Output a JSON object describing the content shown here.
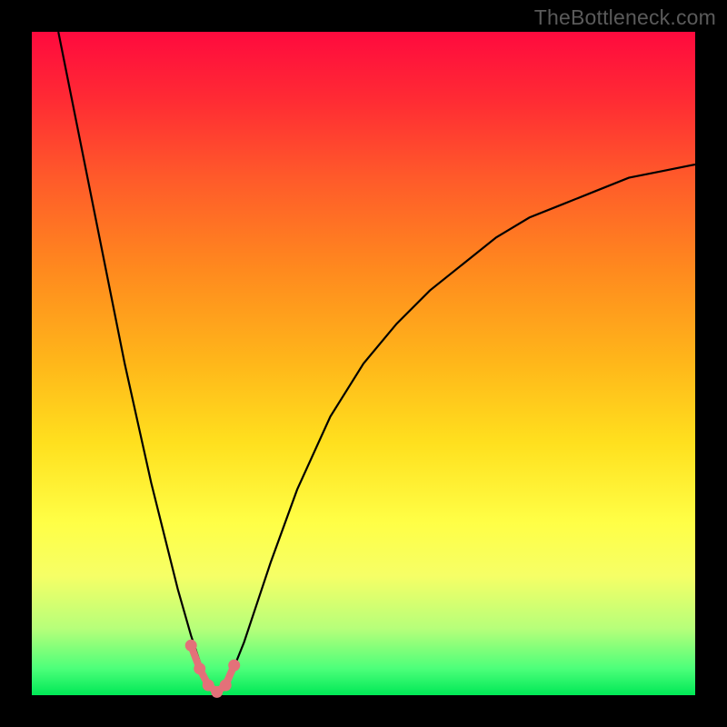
{
  "attribution": "TheBottleneck.com",
  "colors": {
    "background": "#000000",
    "gradient_top": "#ff0a3e",
    "gradient_bottom": "#00e856",
    "curve": "#000000",
    "markers": "#e37179"
  },
  "chart_data": {
    "type": "line",
    "title": "",
    "xlabel": "",
    "ylabel": "",
    "xlim": [
      0,
      100
    ],
    "ylim": [
      0,
      100
    ],
    "grid": false,
    "legend": false,
    "series": [
      {
        "name": "bottleneck-curve",
        "x": [
          4,
          6,
          8,
          10,
          12,
          14,
          16,
          18,
          20,
          22,
          24,
          25,
          26,
          27,
          28,
          29,
          30,
          32,
          34,
          36,
          40,
          45,
          50,
          55,
          60,
          65,
          70,
          75,
          80,
          85,
          90,
          95,
          100
        ],
        "y": [
          100,
          90,
          80,
          70,
          60,
          50,
          41,
          32,
          24,
          16,
          9,
          6,
          3,
          1,
          0,
          1,
          3,
          8,
          14,
          20,
          31,
          42,
          50,
          56,
          61,
          65,
          69,
          72,
          74,
          76,
          78,
          79,
          80
        ]
      }
    ],
    "markers": {
      "name": "highlight-region",
      "x": [
        24.0,
        25.3,
        26.6,
        27.9,
        29.2,
        30.5
      ],
      "y": [
        7.5,
        4.0,
        1.5,
        0.5,
        1.5,
        4.5
      ]
    },
    "annotations": []
  }
}
